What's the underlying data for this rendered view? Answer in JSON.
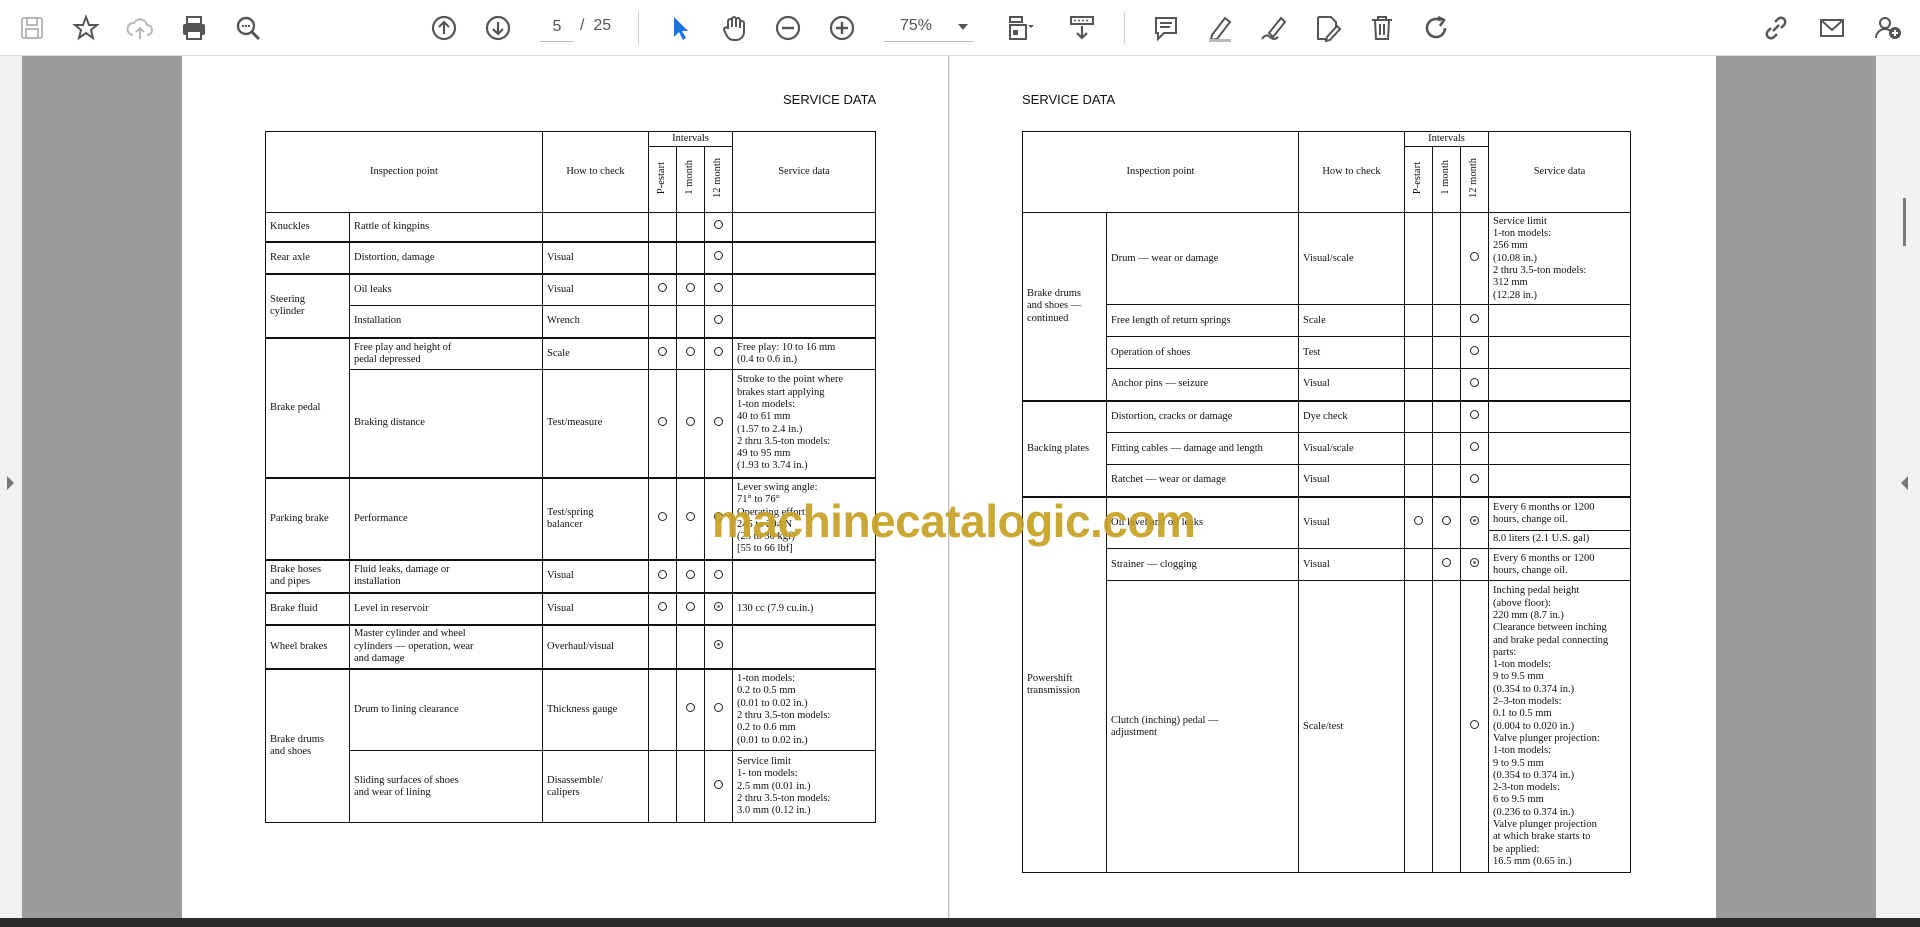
{
  "toolbar": {
    "page_current": "5",
    "page_separator": "/",
    "page_total": "25",
    "zoom": "75%",
    "icons": [
      "save-icon",
      "bookmark-star-icon",
      "cloud-upload-icon",
      "print-icon",
      "zoom-search-icon",
      "page-up-icon",
      "page-down-icon",
      "select-arrow-icon",
      "hand-pan-icon",
      "zoom-out-icon",
      "zoom-in-icon",
      "fit-page-icon",
      "scroll-mode-icon",
      "comment-icon",
      "highlight-pen-icon",
      "draw-icon",
      "edit-text-icon",
      "delete-icon",
      "redo-icon",
      "share-link-icon",
      "email-icon",
      "add-user-icon"
    ]
  },
  "colors": {
    "select_active": "#1a73e8",
    "watermark": "#c8a225",
    "viewer_gray": "#9b9b9b"
  },
  "left_page": {
    "header": "SERVICE DATA",
    "columns": {
      "inspection_point": "Inspection point",
      "how_to_check": "How to check",
      "intervals": "Intervals",
      "prestart": "P-estart",
      "one_month": "1 month",
      "twelve_month": "12 month",
      "service_data": "Service data"
    },
    "rows": [
      {
        "group": "Knuckles",
        "point": "Rattle of kingpins",
        "how": "",
        "marks": [
          "",
          "",
          "o"
        ],
        "data": ""
      },
      {
        "group": "Rear axle",
        "point": "Distortion, damage",
        "how": "Visual",
        "marks": [
          "",
          "",
          "o"
        ],
        "data": ""
      },
      {
        "group": "Steering\ncylinder",
        "point": "Oil leaks",
        "how": "Visual",
        "marks": [
          "o",
          "o",
          "o"
        ],
        "data": ""
      },
      {
        "group": "",
        "point": "Installation",
        "how": "Wrench",
        "marks": [
          "",
          "",
          "o"
        ],
        "data": ""
      },
      {
        "group": "Brake pedal",
        "point": "Free play and height of\npedal depressed",
        "how": "Scale",
        "marks": [
          "o",
          "o",
          "o"
        ],
        "data": "Free play:   10 to 16 mm\n                  (0.4 to 0.6 in.)"
      },
      {
        "group": "",
        "point": "Braking distance",
        "how": "Test/measure",
        "marks": [
          "o",
          "o",
          "o"
        ],
        "data": "Stroke to the point where\nbrakes start applying\n1-ton models:\n40 to 61 mm\n(1.57 to 2.4 in.)\n2 thru 3.5-ton models:\n49 to 95 mm\n(1.93 to 3.74 in.)"
      },
      {
        "group": "Parking brake",
        "point": "Performance",
        "how": "Test/spring\nbalancer",
        "marks": [
          "o",
          "o",
          "o"
        ],
        "data": "Lever swing angle:\n71° to 76°\nOperating effort:\n245 to 294 N\n(25 to 30 kgf)\n[55 to 66 lbf]"
      },
      {
        "group": "Brake hoses\nand pipes",
        "point": "Fluid leaks, damage or\ninstallation",
        "how": "Visual",
        "marks": [
          "o",
          "o",
          "o"
        ],
        "data": ""
      },
      {
        "group": "Brake fluid",
        "point": "Level in reservoir",
        "how": "Visual",
        "marks": [
          "o",
          "o",
          "x"
        ],
        "data": "130 cc (7.9 cu.in.)"
      },
      {
        "group": "Wheel brakes",
        "point": "Master cylinder and wheel\ncylinders — operation, wear\nand damage",
        "how": "Overhaul/visual",
        "marks": [
          "",
          "",
          "x"
        ],
        "data": ""
      },
      {
        "group": "Brake drums\nand shoes",
        "point": "Drum to lining clearance",
        "how": "Thickness gauge",
        "marks": [
          "",
          "o",
          "o"
        ],
        "data": "1-ton models:\n0.2 to 0.5 mm\n(0.01 to 0.02 in.)\n2 thru 3.5-ton models:\n0.2 to 0.6 mm\n(0.01 to 0.02 in.)"
      },
      {
        "group": "",
        "point": "Sliding surfaces of shoes\nand wear of lining",
        "how": "Disassemble/\ncalipers",
        "marks": [
          "",
          "",
          "o"
        ],
        "data": "Service limit\n1- ton models:\n2.5 mm (0.01 in.)\n2 thru 3.5-ton models:\n3.0 mm (0.12 in.)"
      }
    ]
  },
  "right_page": {
    "header": "SERVICE DATA",
    "columns": {
      "inspection_point": "Inspection point",
      "how_to_check": "How to check",
      "intervals": "Intervals",
      "prestart": "P-estart",
      "one_month": "1 month",
      "twelve_month": "12 month",
      "service_data": "Service data"
    },
    "rows": [
      {
        "group": "Brake drums\nand shoes —\ncontinued",
        "point": "Drum — wear or damage",
        "how": "Visual/scale",
        "marks": [
          "",
          "",
          "o"
        ],
        "data": "Service limit\n1-ton models:\n256 mm\n(10.08  in.)\n2 thru 3.5-ton models:\n312  mm\n(12.28 in.)"
      },
      {
        "group": "",
        "point": "Free length of return springs",
        "how": "Scale",
        "marks": [
          "",
          "",
          "o"
        ],
        "data": ""
      },
      {
        "group": "",
        "point": "Operation of shoes",
        "how": "Test",
        "marks": [
          "",
          "",
          "o"
        ],
        "data": ""
      },
      {
        "group": "",
        "point": "Anchor pins — seizure",
        "how": "Visual",
        "marks": [
          "",
          "",
          "o"
        ],
        "data": ""
      },
      {
        "group": "Backing plates",
        "point": "Distortion, cracks or damage",
        "how": "Dye check",
        "marks": [
          "",
          "",
          "o"
        ],
        "data": ""
      },
      {
        "group": "",
        "point": "Fitting cables — damage and length",
        "how": "Visual/scale",
        "marks": [
          "",
          "",
          "o"
        ],
        "data": ""
      },
      {
        "group": "",
        "point": "Ratchet — wear or damage",
        "how": "Visual",
        "marks": [
          "",
          "",
          "o"
        ],
        "data": ""
      },
      {
        "group": "Powershift\ntransmission",
        "point": "Oil level and oil leaks",
        "how": "Visual",
        "marks": [
          "o",
          "o",
          "x"
        ],
        "data": "Every 6 months or 1200\nhours, change oil.",
        "data2": "8.0 liters (2.1 U.S. gal)"
      },
      {
        "group": "",
        "point": "Strainer — clogging",
        "how": "Visual",
        "marks": [
          "",
          "o",
          "x"
        ],
        "data": "Every 6 months or 1200\nhours, change oil."
      },
      {
        "group": "",
        "point": "Clutch (inching) pedal —\nadjustment",
        "how": "Scale/test",
        "marks": [
          "",
          "",
          "o"
        ],
        "data": "Inching pedal height\n(above floor):\n    220 mm (8.7 in.)\nClearance between inching\nand brake pedal connecting\nparts:\n    1-ton models:\n    9 to 9.5 mm\n    (0.354 to 0.374 in.)\n    2–3-ton models:\n    0.1 to 0.5 mm\n    (0.004 to 0.020 in.)\nValve plunger projection:\n    1-ton models:\n    9 to 9.5 mm\n    (0.354 to 0.374 in.)\n    2-3-ton models:\n    6 to 9.5 mm\n    (0.236 to 0.374 in.)\nValve plunger projection\nat which brake starts to\nbe applied:\n    16.5 mm (0.65 in.)"
      }
    ]
  },
  "watermark": "machinecatalogic.com"
}
